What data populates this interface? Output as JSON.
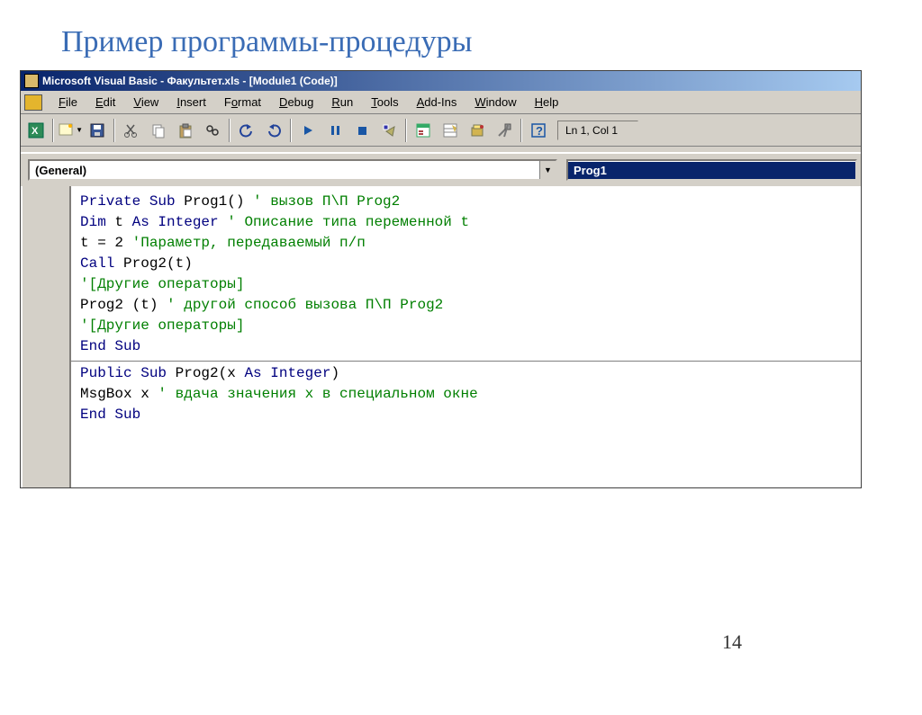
{
  "slide": {
    "title": "Пример программы-процедуры",
    "page": "14"
  },
  "window": {
    "title": "Microsoft Visual Basic - Факультет.xls - [Module1 (Code)]"
  },
  "menu": {
    "items": [
      {
        "pre": "",
        "ul": "F",
        "post": "ile"
      },
      {
        "pre": "",
        "ul": "E",
        "post": "dit"
      },
      {
        "pre": "",
        "ul": "V",
        "post": "iew"
      },
      {
        "pre": "",
        "ul": "I",
        "post": "nsert"
      },
      {
        "pre": "F",
        "ul": "o",
        "post": "rmat"
      },
      {
        "pre": "",
        "ul": "D",
        "post": "ebug"
      },
      {
        "pre": "",
        "ul": "R",
        "post": "un"
      },
      {
        "pre": "",
        "ul": "T",
        "post": "ools"
      },
      {
        "pre": "",
        "ul": "A",
        "post": "dd-Ins"
      },
      {
        "pre": "",
        "ul": "W",
        "post": "indow"
      },
      {
        "pre": "",
        "ul": "H",
        "post": "elp"
      }
    ]
  },
  "toolbar": {
    "status": "Ln 1, Col 1"
  },
  "selectors": {
    "left": "(General)",
    "right": "Prog1"
  },
  "code": {
    "l1_a": "Private Sub ",
    "l1_b": "Prog1() ",
    "l1_c": "' вызов П\\П Prog2",
    "l2_a": "Dim ",
    "l2_b": "t ",
    "l2_c": "As Integer ",
    "l2_d": "' Описание типа переменной t",
    "l3_a": "t = 2 ",
    "l3_b": "'Параметр, передаваемый п/п",
    "l4_a": "Call ",
    "l4_b": "Prog2(t)",
    "l5": "'[Другие операторы]",
    "l6_a": "Prog2 (t) ",
    "l6_b": "' другой способ вызова П\\П Prog2",
    "l7": "'[Другие операторы]",
    "l8": "End Sub",
    "l9_a": "Public Sub ",
    "l9_b": "Prog2(x ",
    "l9_c": "As Integer",
    "l9_d": ")",
    "l10_a": "MsgBox x ",
    "l10_b": "' вдача значения х в специальном окне",
    "l11": "End Sub"
  }
}
